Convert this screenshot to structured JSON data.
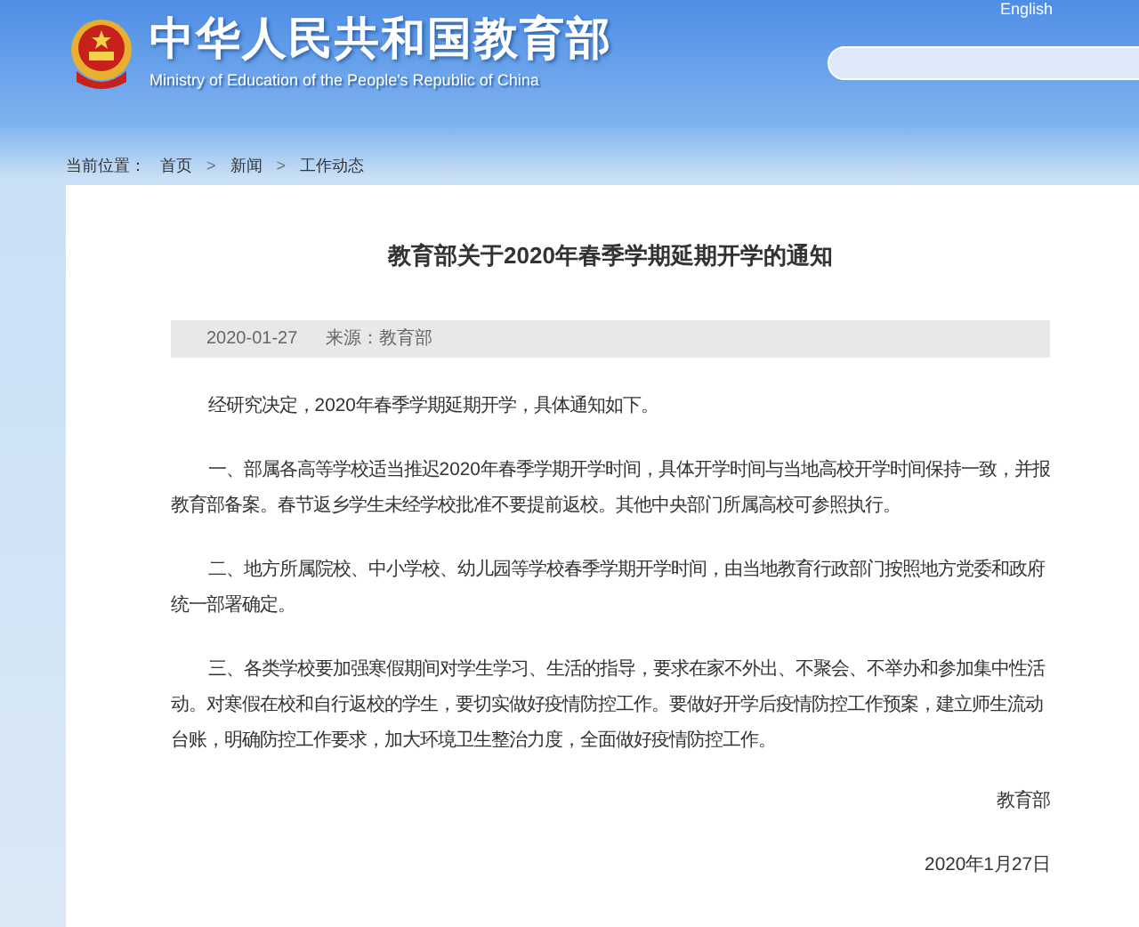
{
  "header": {
    "title": "中华人民共和国教育部",
    "subtitle": "Ministry of Education of the People's Republic of China",
    "top_links": [
      "English"
    ]
  },
  "breadcrumb": {
    "label": "当前位置：",
    "items": [
      "首页",
      "新闻",
      "工作动态"
    ],
    "separator": ">"
  },
  "article": {
    "title": "教育部关于2020年春季学期延期开学的通知",
    "date": "2020-01-27",
    "source": "来源：教育部",
    "paragraphs": [
      "经研究决定，2020年春季学期延期开学，具体通知如下。",
      "一、部属各高等学校适当推迟2020年春季学期开学时间，具体开学时间与当地高校开学时间保持一致，并报教育部备案。春节返乡学生未经学校批准不要提前返校。其他中央部门所属高校可参照执行。",
      "二、地方所属院校、中小学校、幼儿园等学校春季学期开学时间，由当地教育行政部门按照地方党委和政府统一部署确定。",
      "三、各类学校要加强寒假期间对学生学习、生活的指导，要求在家不外出、不聚会、不举办和参加集中性活动。对寒假在校和自行返校的学生，要切实做好疫情防控工作。要做好开学后疫情防控工作预案，建立师生流动台账，明确防控工作要求，加大环境卫生整治力度，全面做好疫情防控工作。"
    ],
    "signature": "教育部",
    "sign_date": "2020年1月27日"
  }
}
